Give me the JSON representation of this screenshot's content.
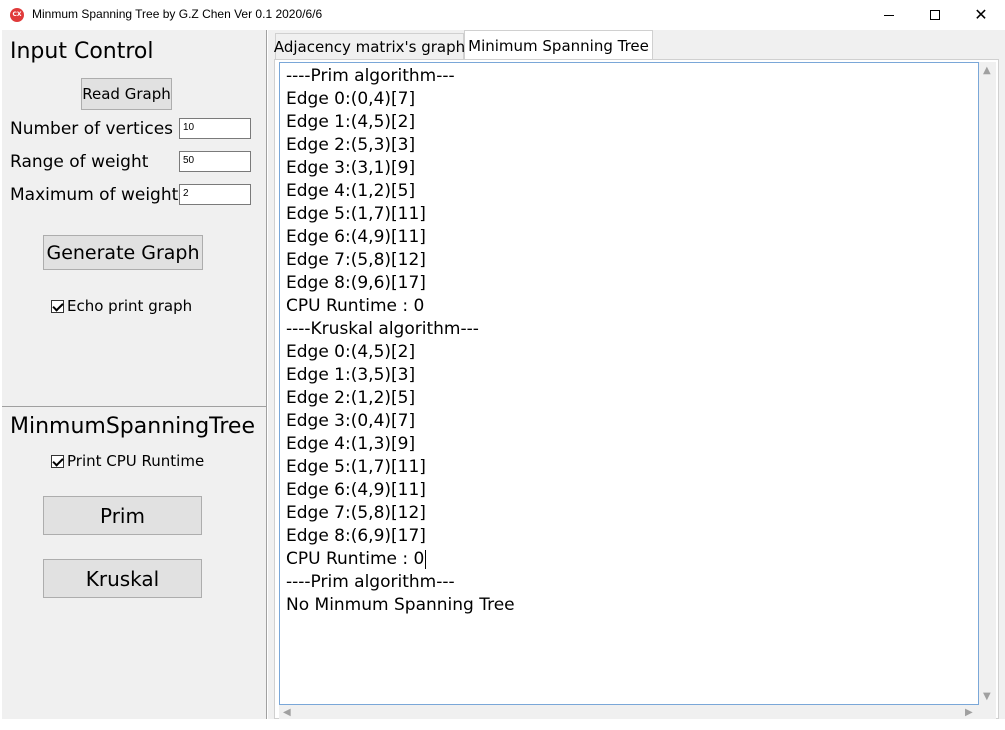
{
  "window": {
    "title": "Minmum Spanning Tree by G.Z Chen Ver 0.1 2020/6/6",
    "icon_text": "CX",
    "minimize_glyph": "",
    "close_glyph": "✕"
  },
  "input_control": {
    "title": "Input Control",
    "read_graph_label": "Read Graph",
    "vertices_label": "Number of vertices",
    "vertices_value": "10",
    "range_label": "Range of weight",
    "range_value": "50",
    "max_label": "Maximum of weight",
    "max_value": "2",
    "generate_label": "Generate Graph",
    "echo_label": "Echo print graph",
    "echo_checked": true
  },
  "mst_control": {
    "title": "MinmumSpanningTree",
    "cpu_label": "Print CPU Runtime",
    "cpu_checked": true,
    "prim_label": "Prim",
    "kruskal_label": "Kruskal"
  },
  "tabs": [
    {
      "label": "Adjacency matrix's graph",
      "active": false
    },
    {
      "label": "Minimum Spanning Tree",
      "active": true
    }
  ],
  "output_lines": [
    "----Prim algorithm---",
    "Edge 0:(0,4)[7]",
    "Edge 1:(4,5)[2]",
    "Edge 2:(5,3)[3]",
    "Edge 3:(3,1)[9]",
    "Edge 4:(1,2)[5]",
    "Edge 5:(1,7)[11]",
    "Edge 6:(4,9)[11]",
    "Edge 7:(5,8)[12]",
    "Edge 8:(9,6)[17]",
    "CPU Runtime : 0",
    "----Kruskal algorithm---",
    "Edge 0:(4,5)[2]",
    "Edge 1:(3,5)[3]",
    "Edge 2:(1,2)[5]",
    "Edge 3:(0,4)[7]",
    "Edge 4:(1,3)[9]",
    "Edge 5:(1,7)[11]",
    "Edge 6:(4,9)[11]",
    "Edge 7:(5,8)[12]",
    "Edge 8:(6,9)[17]",
    "CPU Runtime : 0",
    "----Prim algorithm---",
    "No Minmum Spanning Tree"
  ],
  "caret_after_line": 21,
  "colors": {
    "panel_bg": "#f0f0f0",
    "button_bg": "#e1e1e1",
    "textarea_border": "#7aa7d8",
    "icon_red": "#e03a3a"
  }
}
